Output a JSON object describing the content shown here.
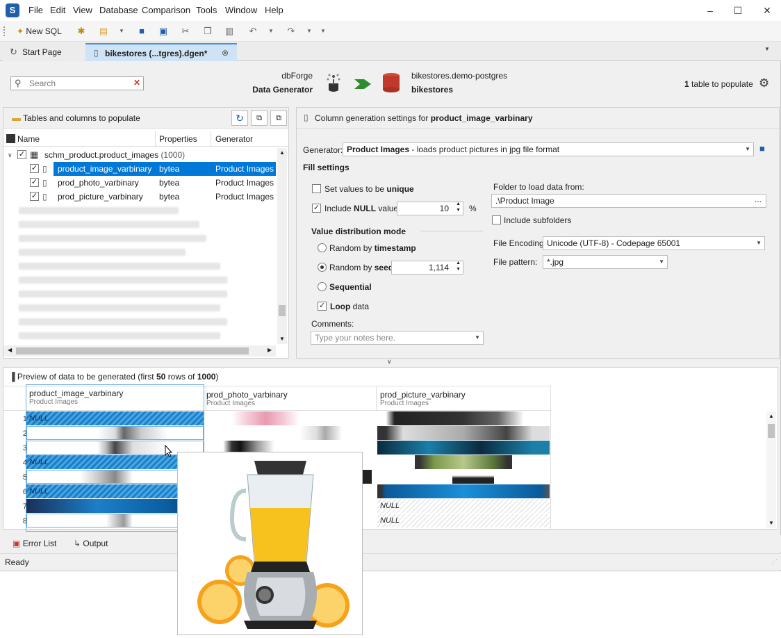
{
  "menu": [
    "File",
    "Edit",
    "View",
    "Database",
    "Comparison",
    "Tools",
    "Window",
    "Help"
  ],
  "toolbar": {
    "new_sql": "New SQL"
  },
  "tabs": [
    {
      "label": "Start Page"
    },
    {
      "label": "bikestores (...tgres).dgen*"
    }
  ],
  "header": {
    "search_placeholder": "Search",
    "product_line1": "dbForge",
    "product_line2": "Data Generator",
    "target_line1": "bikestores.demo-postgres",
    "target_line2": "bikestores",
    "populate_count": "1",
    "populate_text": "table to populate"
  },
  "left": {
    "title": "Tables and columns to populate",
    "columns": [
      "Name",
      "Properties",
      "Generator"
    ],
    "table_name": "schm_product.product_images",
    "table_count": "(1000)",
    "rows": [
      {
        "name": "product_image_varbinary",
        "prop": "bytea",
        "gen": "Product Images"
      },
      {
        "name": "prod_photo_varbinary",
        "prop": "bytea",
        "gen": "Product Images"
      },
      {
        "name": "prod_picture_varbinary",
        "prop": "bytea",
        "gen": "Product Images"
      }
    ]
  },
  "right": {
    "title_prefix": "Column generation settings for",
    "title_column": "product_image_varbinary",
    "generator_label": "Generator:",
    "generator_name": "Product Images",
    "generator_desc": "- loads product pictures in jpg file format",
    "fill_settings": "Fill settings",
    "unique_prefix": "Set values to be",
    "unique_bold": "unique",
    "null_prefix": "Include",
    "null_bold": "NULL",
    "null_suffix": "values",
    "null_value": "10",
    "null_unit": "%",
    "distribution_title": "Value distribution mode",
    "random_timestamp_prefix": "Random by",
    "random_timestamp_bold": "timestamp",
    "random_seed_prefix": "Random by",
    "random_seed_bold": "seed",
    "seed_value": "1,114",
    "sequential": "Sequential",
    "loop_bold": "Loop",
    "loop_suffix": "data",
    "comments_label": "Comments:",
    "comments_placeholder": "Type your notes here.",
    "folder_label": "Folder to load data from:",
    "folder_value": ".\\Product Image",
    "subfolders": "Include subfolders",
    "encoding_label": "File Encoding:",
    "encoding_value": "Unicode (UTF-8) - Codepage 65001",
    "pattern_label": "File pattern:",
    "pattern_value": "*.jpg"
  },
  "preview": {
    "title_prefix": "Preview of data to be generated (first",
    "rows_shown": "50",
    "title_mid": "rows of",
    "rows_total": "1000",
    "title_suffix": ")",
    "columns": [
      {
        "name": "product_image_varbinary",
        "gen": "Product Images"
      },
      {
        "name": "prod_photo_varbinary",
        "gen": "Product Images"
      },
      {
        "name": "prod_picture_varbinary",
        "gen": "Product Images"
      }
    ],
    "row_numbers": [
      "1",
      "2",
      "3",
      "4",
      "5",
      "6",
      "7",
      "8"
    ],
    "null_text": "NULL",
    "ellipsis": "..."
  },
  "bottom": {
    "error_list": "Error List",
    "output": "Output"
  },
  "status": {
    "text": "Ready"
  },
  "colors": {
    "selection": "#0078d7",
    "accent_green": "#2e8b2e",
    "db_red": "#c0392b"
  }
}
